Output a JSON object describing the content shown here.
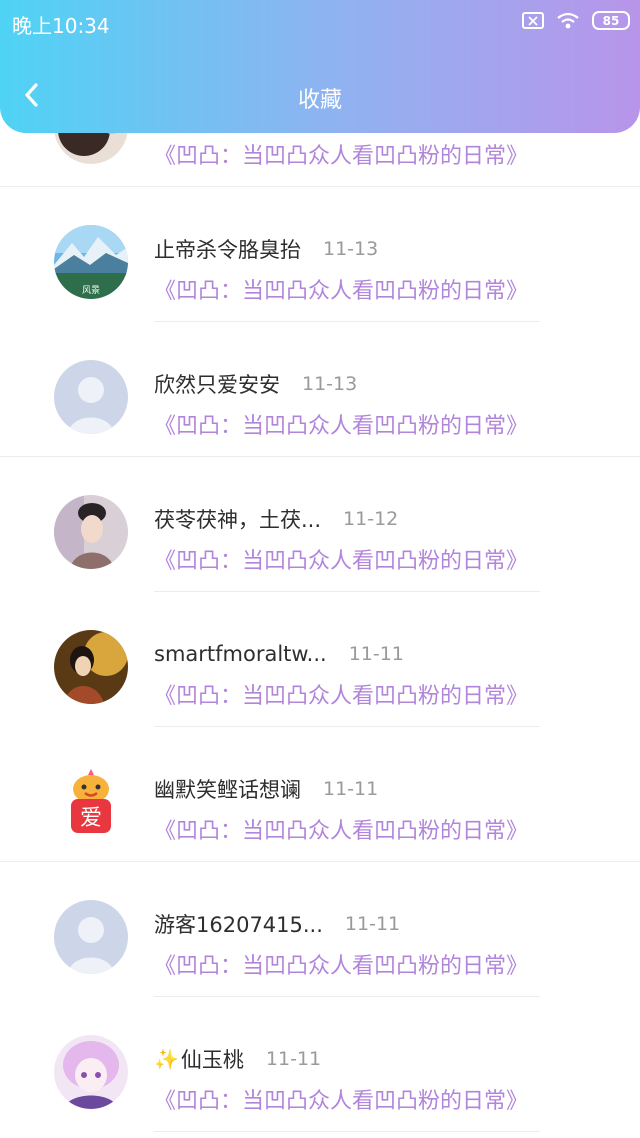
{
  "status_bar": {
    "time": "晚上10:34",
    "battery": "85"
  },
  "header": {
    "title": "收藏"
  },
  "items": [
    {
      "name": "",
      "date": "",
      "work": "《凹凸：当凹凸众人看凹凸粉的日常》",
      "avatar": "dark-photo"
    },
    {
      "name": "止帝杀令胳臭抬",
      "date": "11-13",
      "work": "《凹凸：当凹凸众人看凹凸粉的日常》",
      "avatar": "landscape",
      "avatar_text": "风景"
    },
    {
      "name": "欣然只爱安安",
      "date": "11-13",
      "work": "《凹凸：当凹凸众人看凹凸粉的日常》",
      "avatar": "default"
    },
    {
      "name": "茯苓茯神，土茯...",
      "date": "11-12",
      "work": "《凹凸：当凹凸众人看凹凸粉的日常》",
      "avatar": "portrait"
    },
    {
      "name": "smartfmoraltw...",
      "date": "11-11",
      "work": "《凹凸：当凹凸众人看凹凸粉的日常》",
      "avatar": "warm-photo"
    },
    {
      "name": "幽默笑鲣话想谰",
      "date": "11-11",
      "work": "《凹凸：当凹凸众人看凹凸粉的日常》",
      "avatar": "ai-logo",
      "avatar_text": "爱"
    },
    {
      "name": "游客16207415...",
      "date": "11-11",
      "work": "《凹凸：当凹凸众人看凹凸粉的日常》",
      "avatar": "default"
    },
    {
      "name": "仙玉桃",
      "date": "11-11",
      "work": "《凹凸：当凹凸众人看凹凸粉的日常》",
      "avatar": "anime",
      "prefix": "✨"
    }
  ]
}
